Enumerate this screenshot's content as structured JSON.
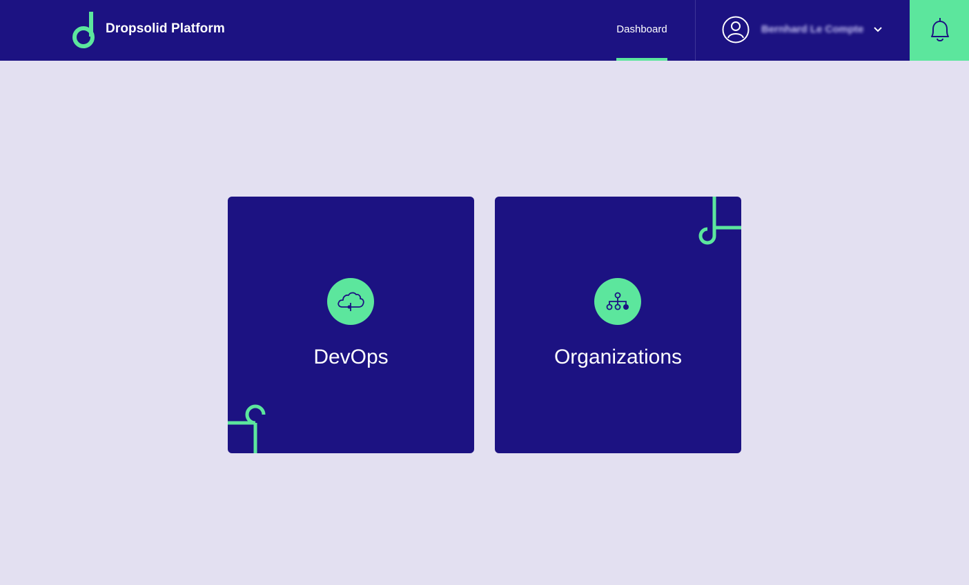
{
  "header": {
    "brand_name": "Dropsolid Platform",
    "logo_icon": "dropsolid-logo-icon",
    "nav": {
      "dashboard_label": "Dashboard",
      "dashboard_active": true
    },
    "user": {
      "name": "Bernhard Le Compte",
      "avatar_icon": "user-avatar-icon",
      "caret_icon": "chevron-down-icon"
    },
    "notifications_icon": "bell-icon"
  },
  "cards": [
    {
      "title": "DevOps",
      "icon": "cloud-icon"
    },
    {
      "title": "Organizations",
      "icon": "hierarchy-icon"
    }
  ],
  "colors": {
    "brand_navy": "#1c1282",
    "accent_green": "#5ce69d",
    "background": "#e3e0f1",
    "text_white": "#ffffff"
  }
}
